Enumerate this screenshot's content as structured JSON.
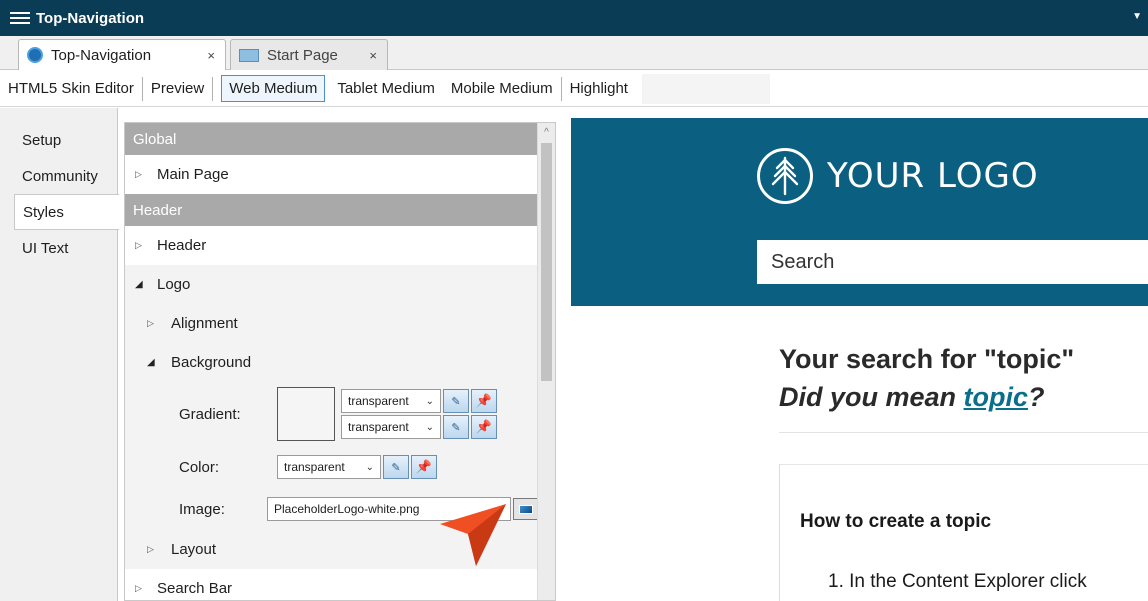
{
  "window": {
    "title": "Top-Navigation"
  },
  "doc_tabs": [
    {
      "label": "Top-Navigation",
      "close": "×"
    },
    {
      "label": "Start Page",
      "close": "×"
    }
  ],
  "toolbar": {
    "editor": "HTML5 Skin Editor",
    "preview": "Preview",
    "web_medium": "Web Medium",
    "tablet_medium": "Tablet Medium",
    "mobile_medium": "Mobile Medium",
    "highlight": "Highlight"
  },
  "side_tabs": [
    "Setup",
    "Community",
    "Styles",
    "UI Text"
  ],
  "props": {
    "global_header": "Global",
    "main_page": "Main Page",
    "header_section": "Header",
    "header_item": "Header",
    "logo": "Logo",
    "alignment": "Alignment",
    "background": "Background",
    "gradient_label": "Gradient:",
    "gradient_value_1": "transparent",
    "gradient_value_2": "transparent",
    "color_label": "Color:",
    "color_value": "transparent",
    "image_label": "Image:",
    "image_value": "PlaceholderLogo-white.png",
    "layout": "Layout",
    "search_bar": "Search Bar"
  },
  "preview": {
    "logo_text": "YOUR LOGO",
    "search_placeholder": "Search",
    "result_title": "Your search for \"topic\"",
    "did_you_mean": "Did you mean ",
    "suggestion": "topic",
    "question_mark": "?",
    "card_title": "How to create a topic",
    "card_step": "1.  In the Content Explorer click"
  },
  "colors": {
    "titlebar": "#0b3c55",
    "preview_header": "#0b5f80",
    "accent_link": "#0b6f8c",
    "cursor_arrow": "#f04e23"
  }
}
